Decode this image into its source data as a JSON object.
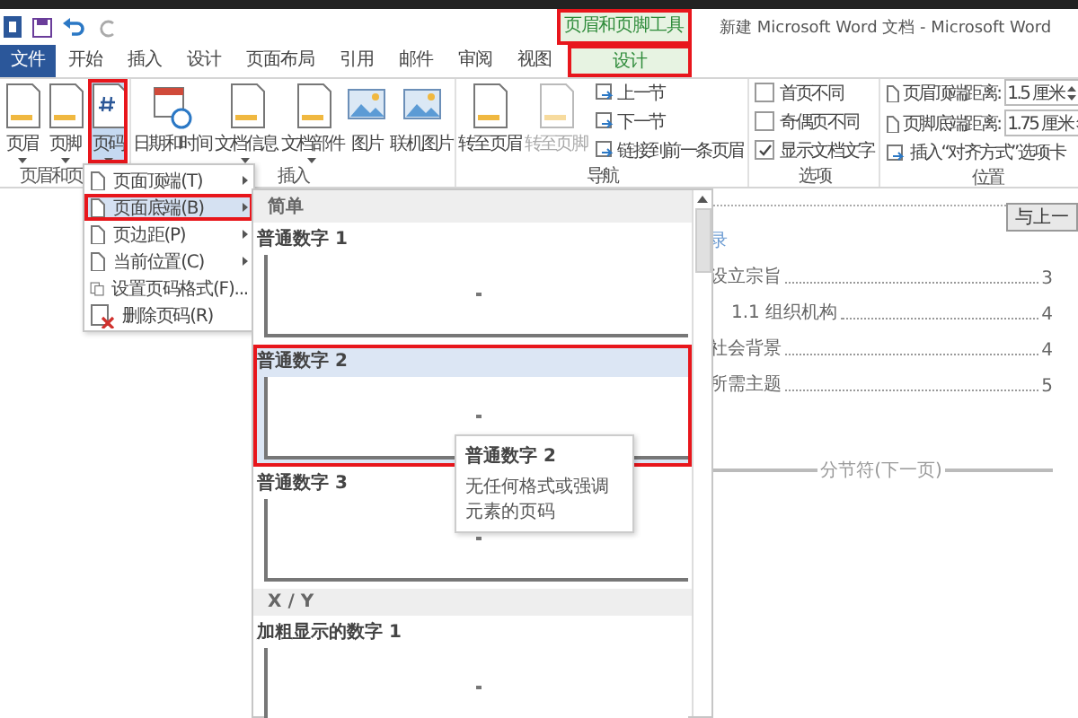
{
  "window": {
    "title": "新建 Microsoft Word 文档 - Microsoft Word",
    "context_tab": {
      "label": "页眉和页脚工具",
      "annotated": true
    }
  },
  "tabs": [
    {
      "label": "文件",
      "kind": "file",
      "selected": false,
      "annotated": false
    },
    {
      "label": "开始",
      "kind": "tab",
      "selected": false,
      "annotated": false
    },
    {
      "label": "插入",
      "kind": "tab",
      "selected": false,
      "annotated": false
    },
    {
      "label": "设计",
      "kind": "tab",
      "selected": false,
      "annotated": false
    },
    {
      "label": "页面布局",
      "kind": "tab",
      "selected": false,
      "annotated": false
    },
    {
      "label": "引用",
      "kind": "tab",
      "selected": false,
      "annotated": false
    },
    {
      "label": "邮件",
      "kind": "tab",
      "selected": false,
      "annotated": false
    },
    {
      "label": "审阅",
      "kind": "tab",
      "selected": false,
      "annotated": false
    },
    {
      "label": "视图",
      "kind": "tab",
      "selected": false,
      "annotated": false
    },
    {
      "label": "设计",
      "kind": "context",
      "selected": true,
      "annotated": true
    }
  ],
  "ribbon": [
    {
      "label": "页眉和页",
      "items": [
        {
          "kind": "large",
          "label": "页眉",
          "dropdown": true,
          "selected": false,
          "disabled": false,
          "annotated": false
        },
        {
          "kind": "large",
          "label": "页脚",
          "dropdown": true,
          "selected": false,
          "disabled": false,
          "annotated": false
        },
        {
          "kind": "large",
          "label": "页码",
          "dropdown": true,
          "selected": true,
          "disabled": false,
          "annotated": true
        }
      ]
    },
    {
      "label": "插入",
      "items": [
        {
          "kind": "large",
          "label": "日期和时间",
          "dropdown": false,
          "selected": false,
          "disabled": false,
          "annotated": false
        },
        {
          "kind": "large",
          "label": "文档信息",
          "dropdown": true,
          "selected": false,
          "disabled": false,
          "annotated": false
        },
        {
          "kind": "large",
          "label": "文档部件",
          "dropdown": true,
          "selected": false,
          "disabled": false,
          "annotated": false
        },
        {
          "kind": "large",
          "label": "图片",
          "dropdown": false,
          "selected": false,
          "disabled": false,
          "annotated": false
        },
        {
          "kind": "large",
          "label": "联机图片",
          "dropdown": false,
          "selected": false,
          "disabled": false,
          "annotated": false
        }
      ]
    },
    {
      "label": "导航",
      "items": [
        {
          "kind": "large",
          "label": "转至页眉",
          "dropdown": false,
          "selected": false,
          "disabled": false,
          "annotated": false
        },
        {
          "kind": "large",
          "label": "转至页脚",
          "dropdown": false,
          "selected": false,
          "disabled": true,
          "annotated": false
        },
        {
          "kind": "stack",
          "rows": [
            {
              "kind": "small",
              "label": "上一节"
            },
            {
              "kind": "small",
              "label": "下一节"
            },
            {
              "kind": "small",
              "label": "链接到前一条页眉"
            }
          ]
        }
      ]
    },
    {
      "label": "选项",
      "items": [
        {
          "kind": "stack",
          "rows": [
            {
              "kind": "checkbox",
              "label": "首页不同",
              "checked": false
            },
            {
              "kind": "checkbox",
              "label": "奇偶页不同",
              "checked": false
            },
            {
              "kind": "checkbox",
              "label": "显示文档文字",
              "checked": true
            }
          ]
        }
      ]
    },
    {
      "label": "位置",
      "items": [
        {
          "kind": "stack",
          "rows": [
            {
              "kind": "spin",
              "label": "页眉顶端距离:",
              "value": "1.5 厘米"
            },
            {
              "kind": "spin",
              "label": "页脚底端距离:",
              "value": "1.75 厘米"
            },
            {
              "kind": "small",
              "label": "插入“对齐方式”选项卡"
            }
          ]
        }
      ]
    }
  ],
  "document": {
    "toc_title": "录",
    "toc": [
      {
        "label": "设立宗旨",
        "page": "3",
        "indent": false
      },
      {
        "label": "1.1 组织机构",
        "page": "4",
        "indent": true
      },
      {
        "label": "社会背景",
        "page": "4",
        "indent": false
      },
      {
        "label": "所需主题",
        "page": "5",
        "indent": false
      }
    ],
    "section_break": "分节符(下一页)",
    "link_button": "与上一"
  },
  "menu": [
    {
      "label": "页面顶端(T)",
      "submenu": true,
      "selected": false,
      "annotated": false
    },
    {
      "label": "页面底端(B)",
      "submenu": true,
      "selected": true,
      "annotated": true
    },
    {
      "label": "页边距(P)",
      "submenu": true,
      "selected": false,
      "annotated": false
    },
    {
      "label": "当前位置(C)",
      "submenu": true,
      "selected": false,
      "annotated": false
    },
    {
      "label": "设置页码格式(F)...",
      "submenu": false,
      "selected": false,
      "annotated": false
    },
    {
      "label": "删除页码(R)",
      "submenu": false,
      "selected": false,
      "annotated": false
    }
  ],
  "gallery": [
    {
      "kind": "header",
      "label": "简单"
    },
    {
      "kind": "item",
      "label": "普通数字 1",
      "selected": false,
      "annotated": false
    },
    {
      "kind": "item",
      "label": "普通数字 2",
      "selected": true,
      "annotated": true
    },
    {
      "kind": "item",
      "label": "普通数字 3",
      "selected": false,
      "annotated": false
    },
    {
      "kind": "header",
      "label": "X / Y"
    },
    {
      "kind": "item",
      "label": "加粗显示的数字 1",
      "selected": false,
      "annotated": false
    }
  ],
  "tooltip": {
    "title": "普通数字 2",
    "text": "无任何格式或强调元素的页码"
  }
}
